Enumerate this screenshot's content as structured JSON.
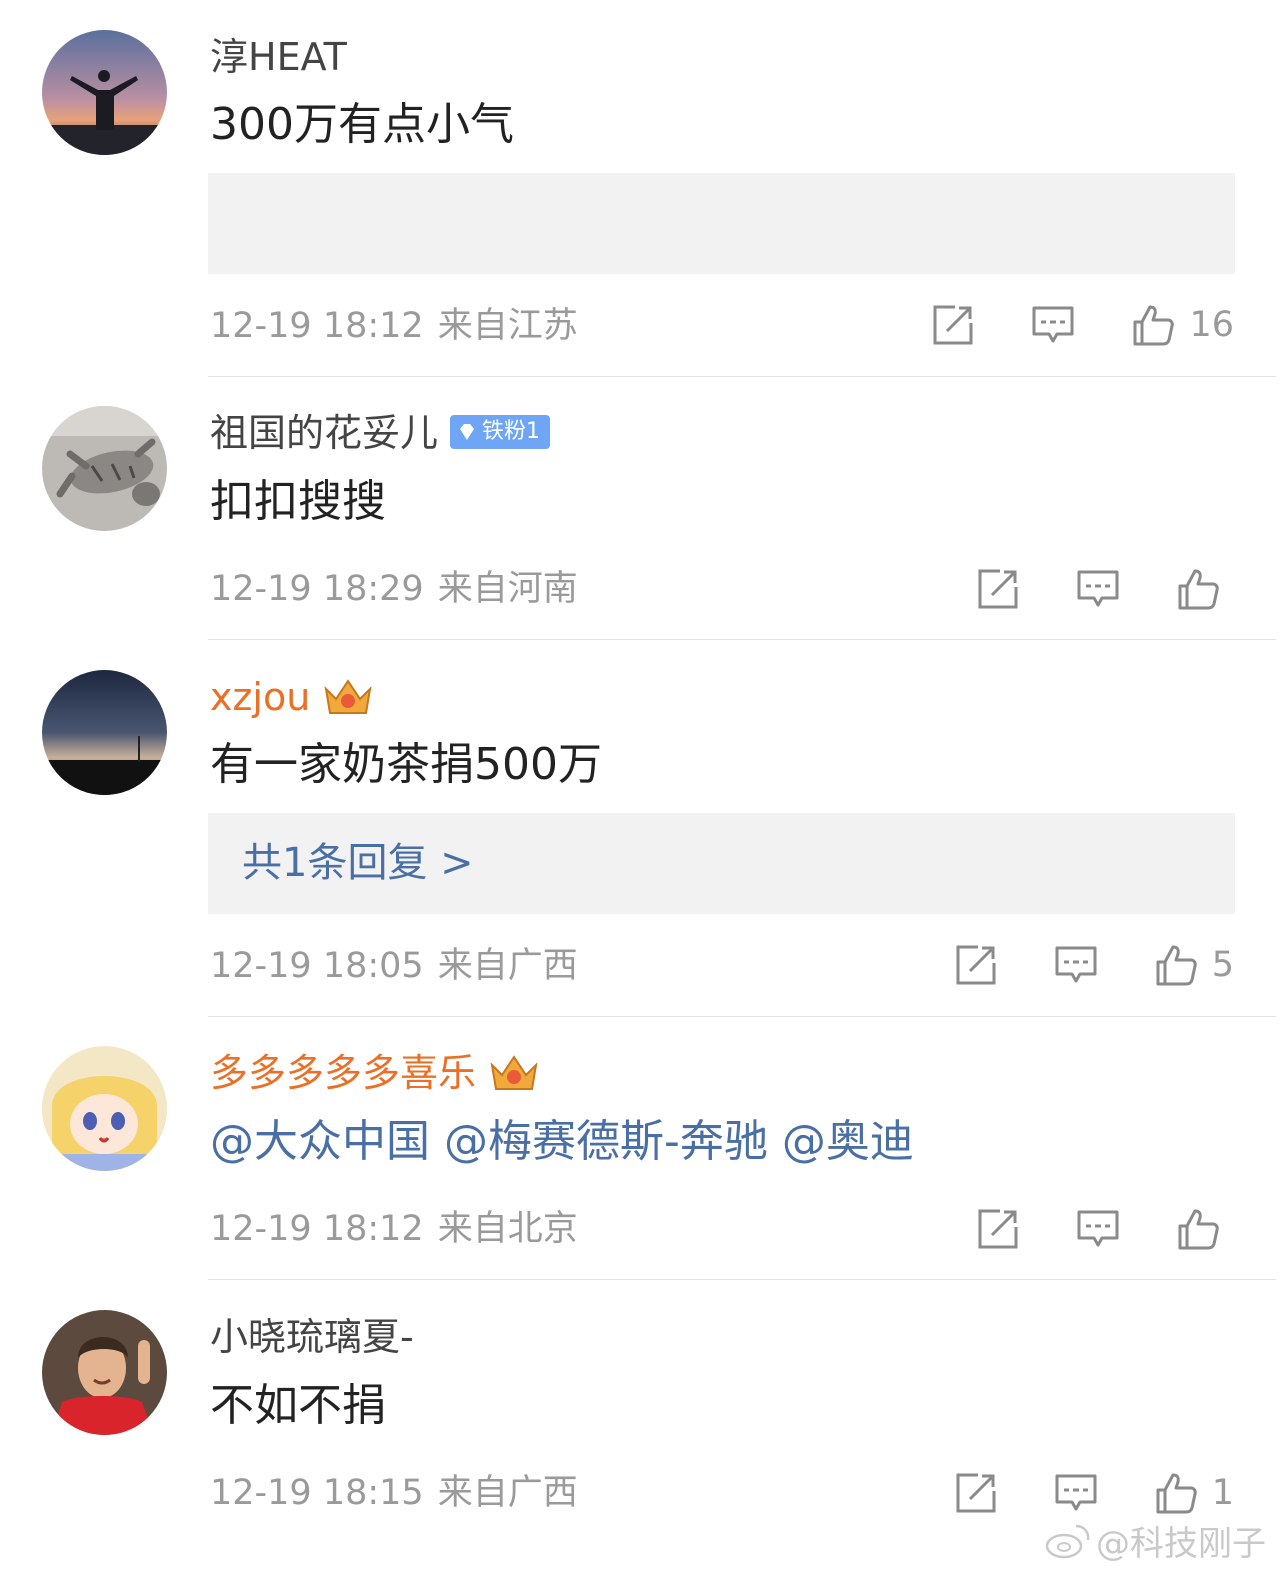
{
  "comments": [
    {
      "username": "淳HEAT",
      "text": "300万有点小气",
      "time": "12-19 18:12",
      "location": "来自江苏",
      "likes": "16"
    },
    {
      "username": "祖国的花妥儿",
      "badge": "铁粉1",
      "text": "扣扣搜搜",
      "time": "12-19 18:29",
      "location": "来自河南",
      "likes": ""
    },
    {
      "username": "xzjou",
      "text": "有一家奶茶捐500万",
      "reply_link": "共1条回复 >",
      "time": "12-19 18:05",
      "location": "来自广西",
      "likes": "5"
    },
    {
      "username": "多多多多多喜乐",
      "mentions": [
        "@大众中国",
        "@梅赛德斯-奔驰",
        "@奥迪"
      ],
      "time": "12-19 18:12",
      "location": "来自北京",
      "likes": ""
    },
    {
      "username": "小晓琉璃夏-",
      "text": "不如不捐",
      "time": "12-19 18:15",
      "location": "来自广西",
      "likes": "1"
    }
  ],
  "watermark": "@科技刚子",
  "colors": {
    "vip_name": "#eb7026",
    "mention": "#4a6fa5",
    "meta": "#9a9a9a",
    "badge": "#6ea6f5"
  }
}
